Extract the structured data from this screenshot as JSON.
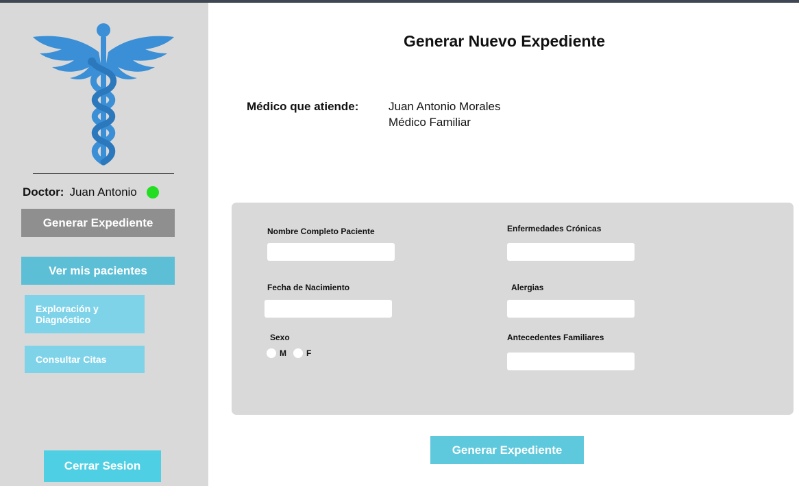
{
  "sidebar": {
    "doctor_label": "Doctor:",
    "doctor_name": "Juan Antonio",
    "status_color": "#22dd22",
    "buttons": {
      "generar": "Generar Expediente",
      "ver_pacientes": "Ver mis pacientes",
      "exploracion": "Exploración  y\nDiagnóstico",
      "consultar_citas": "Consultar Citas",
      "cerrar_sesion": "Cerrar Sesion"
    }
  },
  "main": {
    "title": "Generar Nuevo Expediente",
    "medico_label": "Médico que atiende:",
    "medico_name": "Juan Antonio Morales",
    "medico_role": "Médico Familiar",
    "form": {
      "nombre_label": "Nombre Completo Paciente",
      "fecha_label": "Fecha de Nacimiento",
      "sexo_label": "Sexo",
      "sexo_options": [
        "M",
        "F"
      ],
      "enfermedades_label": "Enfermedades Crónicas",
      "alergias_label": "Alergias",
      "antecedentes_label": "Antecedentes Familiares",
      "nombre_value": "",
      "fecha_value": "",
      "enfermedades_value": "",
      "alergias_value": "",
      "antecedentes_value": ""
    },
    "submit_label": "Generar Expediente"
  },
  "colors": {
    "sidebar_bg": "#d9d9d9",
    "primary_button": "#5cbfd6",
    "secondary_button": "#7fd3e9",
    "disabled_button": "#8f8f8f",
    "logo_blue": "#3a8fd6"
  },
  "icons": {
    "logo": "caduceus-icon",
    "status": "online-status-dot"
  }
}
